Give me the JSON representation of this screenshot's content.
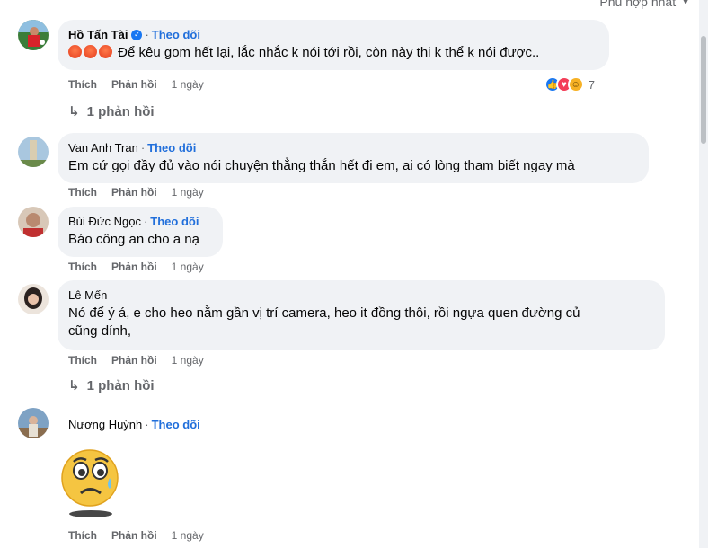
{
  "sort_label": "Phù hợp nhất",
  "follow_label": "Theo dõi",
  "like_label": "Thích",
  "reply_label": "Phản hồi",
  "comments": [
    {
      "author": "Hồ Tấn Tài",
      "verified": true,
      "text": "Để kêu gom hết lại, lắc nhắc k nói tới rồi, còn này thi k thể k nói được..",
      "time": "1 ngày",
      "reaction_count": "7",
      "replies": "1 phản hồi"
    },
    {
      "author": "Van Anh Tran",
      "text": "Em cứ gọi đầy đủ vào nói chuyện thẳng thắn hết đi em, ai có lòng tham biết ngay mà",
      "time": "1 ngày"
    },
    {
      "author": "Bùi Đức Ngọc",
      "text": "Báo công an cho a nạ",
      "time": "1 ngày"
    },
    {
      "author": "Lê Mến",
      "text_line1": "Nó để ý á, e cho heo nằm gần vị trí camera, heo it đồng thôi, rồi ngựa quen đường củ",
      "text_line2": "cũng dính,",
      "time": "1 ngày",
      "replies": "1 phản hồi"
    },
    {
      "author": "Nương Huỳnh",
      "sticker": "worried-crying-emoji",
      "time": "1 ngày"
    }
  ]
}
